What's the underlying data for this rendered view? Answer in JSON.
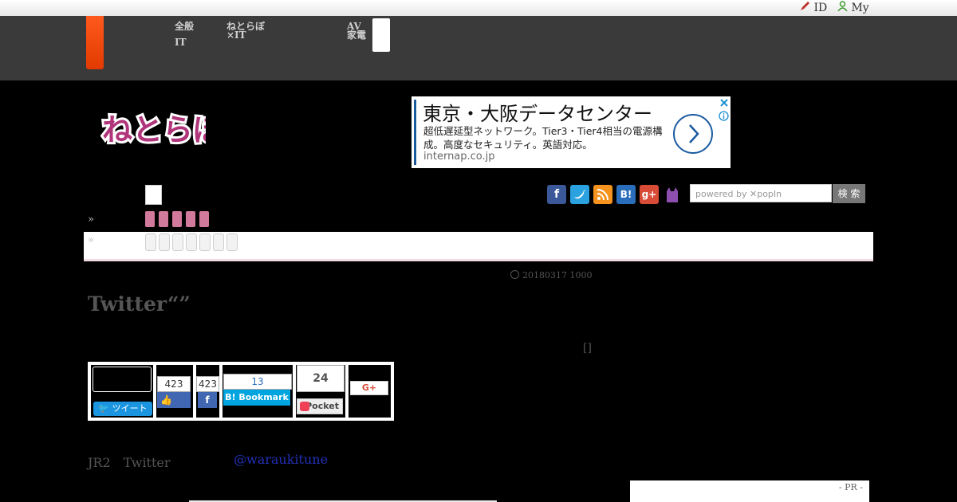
{
  "util": {
    "id_link": "ID",
    "my_link": "My"
  },
  "nav": {
    "item1_line1": "全般",
    "item1_line2": "IT",
    "item2_line1": "ねとらぼ",
    "item2_line2": "×IT",
    "item3_line1": "AV",
    "item3_line2": "家電"
  },
  "ad": {
    "title": "東京・大阪データセンター",
    "body": "超低遅延型ネットワーク。Tier3・Tier4相当の電源構成。高度なセキュリティ。英語対応。",
    "url": "internap.co.jp",
    "brand_color": "#1a5a9a"
  },
  "site": {
    "logo_text": "ねとらぼ",
    "logo_color": "#b0357a"
  },
  "social": [
    "facebook-icon",
    "twitter-icon",
    "rss-icon",
    "hatena-icon",
    "google-plus-icon",
    "cat-icon"
  ],
  "search": {
    "placeholder": "powered by ✕popIn",
    "button": "検 索"
  },
  "breadcrumb": {
    "raquo1": "»",
    "raquo2": "»"
  },
  "article": {
    "date": "20180317 1000",
    "title": "Twitter“”",
    "bracket": "[]",
    "body_prefix": "JR2　Twitter",
    "handle": "@waraukitune"
  },
  "share": {
    "tweet_label": "ツイート",
    "like_count": "423",
    "fb_share_count": "423",
    "bookmark_count": "13",
    "bookmark_label": "Bookmark",
    "pocket_count": "24",
    "pocket_label": "Pocket",
    "gplus_label": "G+"
  },
  "pr": {
    "label": "- PR -"
  }
}
